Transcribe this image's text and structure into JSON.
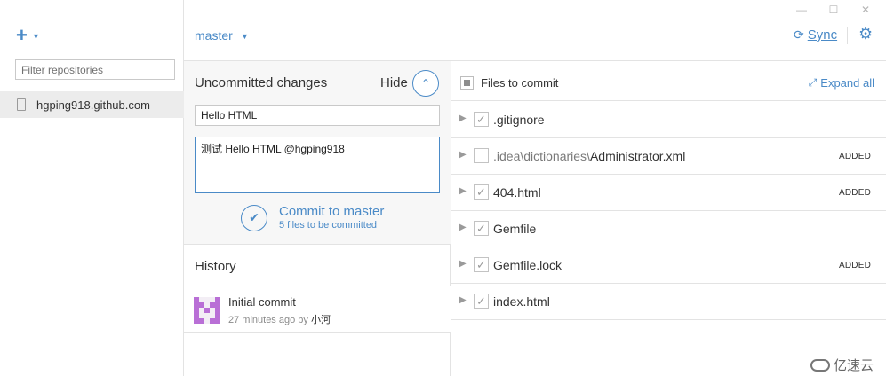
{
  "window": {
    "minimize_glyph": "—",
    "maximize_glyph": "☐",
    "close_glyph": "✕"
  },
  "sidebar": {
    "add_glyph": "+",
    "filter_placeholder": "Filter repositories",
    "repo": "hgping918.github.com"
  },
  "header": {
    "branch": "master",
    "sync_glyph": "⟳",
    "sync_label": "Sync",
    "gear_glyph": "⚙"
  },
  "uncommitted": {
    "title": "Uncommitted changes",
    "hide_label": "Hide",
    "summary_value": "Hello HTML",
    "description_value": "测试 Hello HTML @hgping918",
    "commit_label": "Commit to master",
    "commit_sub": "5 files to be committed"
  },
  "history": {
    "title": "History",
    "commits": [
      {
        "message": "Initial commit",
        "time": "27 minutes ago by ",
        "author": "小河"
      }
    ]
  },
  "files": {
    "header_label": "Files to commit",
    "expand_label": "Expand all",
    "items": [
      {
        "dir": "",
        "name": ".gitignore",
        "status": "",
        "checked": true
      },
      {
        "dir": ".idea\\dictionaries\\",
        "name": "Administrator.xml",
        "status": "ADDED",
        "checked": false
      },
      {
        "dir": "",
        "name": "404.html",
        "status": "ADDED",
        "checked": true
      },
      {
        "dir": "",
        "name": "Gemfile",
        "status": "",
        "checked": true
      },
      {
        "dir": "",
        "name": "Gemfile.lock",
        "status": "ADDED",
        "checked": true
      },
      {
        "dir": "",
        "name": "index.html",
        "status": "",
        "checked": true
      }
    ]
  },
  "watermark": "亿速云"
}
